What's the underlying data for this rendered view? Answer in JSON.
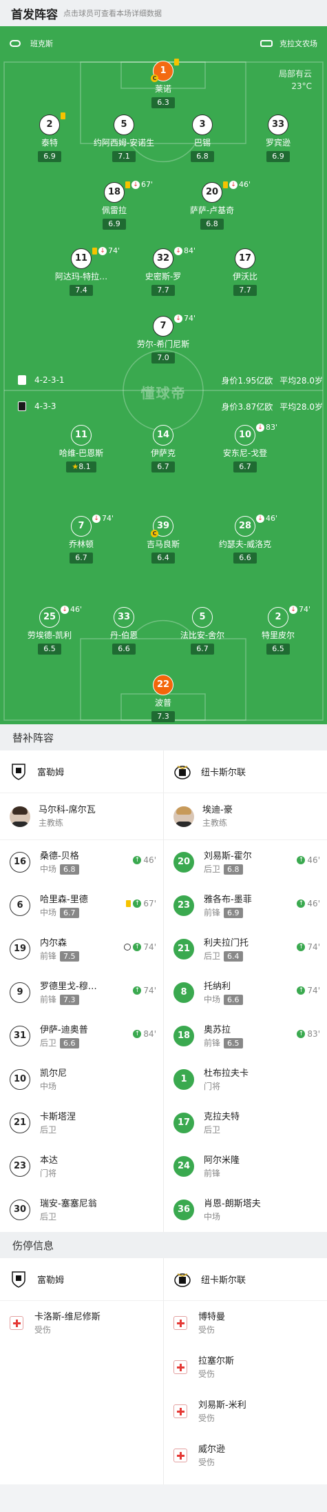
{
  "header": {
    "title": "首发阵容",
    "hint": "点击球员可查看本场详细数据"
  },
  "teams": {
    "home": "班克斯",
    "away": "克拉文农场"
  },
  "weather": {
    "condition": "局部有云",
    "temp": "23°C"
  },
  "watermark": "懂球帝",
  "home_lineup": {
    "formation": "4-2-3-1",
    "value": "身价1.95亿欧",
    "age": "平均28.0岁",
    "players": [
      {
        "num": "1",
        "name": "莱诺",
        "rating": "6.3"
      },
      {
        "num": "2",
        "name": "泰特",
        "rating": "6.9"
      },
      {
        "num": "5",
        "name": "约阿西姆-安诺生",
        "rating": "7.1"
      },
      {
        "num": "3",
        "name": "巴锡",
        "rating": "6.8"
      },
      {
        "num": "33",
        "name": "罗宾逊",
        "rating": "6.9"
      },
      {
        "num": "18",
        "name": "佩雷拉",
        "rating": "6.9",
        "minute": "67'"
      },
      {
        "num": "20",
        "name": "萨萨-卢基奇",
        "rating": "6.8",
        "minute": "46'"
      },
      {
        "num": "11",
        "name": "阿达玛-特拉…",
        "rating": "7.4",
        "minute": "74'"
      },
      {
        "num": "32",
        "name": "史密斯-罗",
        "rating": "7.7",
        "minute": "84'"
      },
      {
        "num": "17",
        "name": "伊沃比",
        "rating": "7.7"
      },
      {
        "num": "7",
        "name": "劳尔-希门尼斯",
        "rating": "7.0",
        "minute": "74'"
      }
    ]
  },
  "away_lineup": {
    "formation": "4-3-3",
    "value": "身价3.87亿欧",
    "age": "平均28.0岁",
    "players": [
      {
        "num": "11",
        "name": "哈维-巴恩斯",
        "rating": "8.1"
      },
      {
        "num": "14",
        "name": "伊萨克",
        "rating": "6.7"
      },
      {
        "num": "10",
        "name": "安东尼-戈登",
        "rating": "6.7",
        "minute": "83'"
      },
      {
        "num": "7",
        "name": "乔林顿",
        "rating": "6.7",
        "minute": "74'"
      },
      {
        "num": "39",
        "name": "吉马良斯",
        "rating": "6.4"
      },
      {
        "num": "28",
        "name": "约瑟夫-威洛克",
        "rating": "6.6",
        "minute": "46'"
      },
      {
        "num": "25",
        "name": "劳埃德-凯利",
        "rating": "6.5",
        "minute": "46'"
      },
      {
        "num": "33",
        "name": "丹-伯恩",
        "rating": "6.6"
      },
      {
        "num": "5",
        "name": "法比安-舍尔",
        "rating": "6.7"
      },
      {
        "num": "2",
        "name": "特里皮尔",
        "rating": "6.5",
        "minute": "74'"
      },
      {
        "num": "22",
        "name": "波普",
        "rating": "7.3"
      }
    ]
  },
  "subs_section": {
    "title": "替补阵容",
    "home_team": "富勒姆",
    "away_team": "纽卡斯尔联",
    "home_coach": {
      "name": "马尔科-席尔瓦",
      "role": "主教练"
    },
    "away_coach": {
      "name": "埃迪-豪",
      "role": "主教练"
    },
    "home_subs": [
      {
        "num": "16",
        "name": "桑德-贝格",
        "pos": "中场",
        "rating": "6.8",
        "minute": "46'"
      },
      {
        "num": "6",
        "name": "哈里森-里德",
        "pos": "中场",
        "rating": "6.7",
        "minute": "67'"
      },
      {
        "num": "19",
        "name": "内尔森",
        "pos": "前锋",
        "rating": "7.5",
        "minute": "74'"
      },
      {
        "num": "9",
        "name": "罗德里戈-穆…",
        "pos": "前锋",
        "rating": "7.3",
        "minute": "74'"
      },
      {
        "num": "31",
        "name": "伊萨-迪奥普",
        "pos": "后卫",
        "rating": "6.6",
        "minute": "84'"
      },
      {
        "num": "10",
        "name": "凯尔尼",
        "pos": "中场"
      },
      {
        "num": "21",
        "name": "卡斯塔涅",
        "pos": "后卫"
      },
      {
        "num": "23",
        "name": "本达",
        "pos": "门将"
      },
      {
        "num": "30",
        "name": "瑞安-塞塞尼翁",
        "pos": "后卫"
      }
    ],
    "away_subs": [
      {
        "num": "20",
        "name": "刘易斯-霍尔",
        "pos": "后卫",
        "rating": "6.8",
        "minute": "46'"
      },
      {
        "num": "23",
        "name": "雅各布-墨菲",
        "pos": "前锋",
        "rating": "6.9",
        "minute": "46'"
      },
      {
        "num": "21",
        "name": "利夫拉门托",
        "pos": "后卫",
        "rating": "6.4",
        "minute": "74'"
      },
      {
        "num": "8",
        "name": "托纳利",
        "pos": "中场",
        "rating": "6.6",
        "minute": "74'"
      },
      {
        "num": "18",
        "name": "奥苏拉",
        "pos": "前锋",
        "rating": "6.5",
        "minute": "83'"
      },
      {
        "num": "1",
        "name": "杜布拉夫卡",
        "pos": "门将"
      },
      {
        "num": "17",
        "name": "克拉夫特",
        "pos": "后卫"
      },
      {
        "num": "24",
        "name": "阿尔米隆",
        "pos": "前锋"
      },
      {
        "num": "36",
        "name": "肖恩-朗斯塔夫",
        "pos": "中场"
      }
    ]
  },
  "injury_section": {
    "title": "伤停信息",
    "home_team": "富勒姆",
    "away_team": "纽卡斯尔联",
    "home": [
      {
        "name": "卡洛斯-维尼修斯",
        "status": "受伤"
      }
    ],
    "away": [
      {
        "name": "博特曼",
        "status": "受伤"
      },
      {
        "name": "拉塞尔斯",
        "status": "受伤"
      },
      {
        "name": "刘易斯-米利",
        "status": "受伤"
      },
      {
        "name": "威尔逊",
        "status": "受伤"
      }
    ]
  },
  "colors": {
    "pitch": "#3aa94f",
    "rating_bg": "#1f6b32",
    "gk_home": "#f36a12",
    "sub_in": "#3aa94f",
    "sub_out": "#e53935",
    "yellow_card": "#f6c300"
  },
  "icons": [
    "whistle-icon",
    "shirt-icon",
    "sub-off-icon",
    "sub-on-icon",
    "yellow-card-icon",
    "ball-icon",
    "captain-icon",
    "star-icon",
    "medical-kit-icon"
  ]
}
